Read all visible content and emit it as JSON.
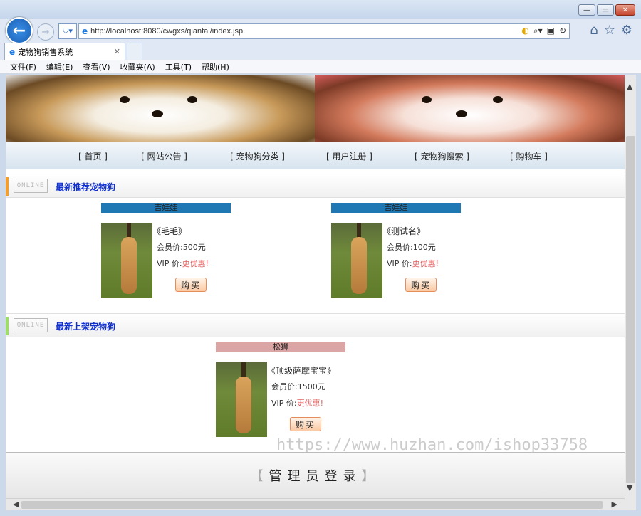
{
  "browser": {
    "url_host": "http://localhost:",
    "url_rest": "8080/cwgxs/qiantai/index.jsp",
    "tab_title": "宠物狗销售系统",
    "menu": [
      "文件(F)",
      "编辑(E)",
      "查看(V)",
      "收藏夹(A)",
      "工具(T)",
      "帮助(H)"
    ]
  },
  "site": {
    "nav": [
      "[ 首页 ]",
      "[ 网站公告 ]",
      "[ 宠物狗分类 ]",
      "[ 用户注册 ]",
      "[ 宠物狗搜索 ]",
      "[ 购物车 ]"
    ],
    "section_logo_text": "ONLINE",
    "sections": {
      "recommended": {
        "title": "最新推荐宠物狗",
        "products": [
          {
            "category": "吉娃娃",
            "name": "《毛毛》",
            "price_label": "会员价:",
            "price": "500元",
            "vip_label": "VIP 价:",
            "vip_value": "更优惠!",
            "buy": "购买"
          },
          {
            "category": "吉娃娃",
            "name": "《测试名》",
            "price_label": "会员价:",
            "price": "100元",
            "vip_label": "VIP 价:",
            "vip_value": "更优惠!",
            "buy": "购买"
          }
        ]
      },
      "new": {
        "title": "最新上架宠物狗",
        "products": [
          {
            "category": "松狮",
            "name": "《顶级萨摩宝宝》",
            "price_label": "会员价:",
            "price": "1500元",
            "vip_label": "VIP 价:",
            "vip_value": "更优惠!",
            "buy": "购买"
          }
        ]
      }
    },
    "footer": {
      "left": "【",
      "text": "管理员登录",
      "right": "】"
    },
    "watermark": "https://www.huzhan.com/ishop33758"
  },
  "colors": {
    "category_blue": "#1f77b4",
    "category_pink": "#dca5a5",
    "title_blue": "#1030d0",
    "vip_red": "#e06060"
  }
}
